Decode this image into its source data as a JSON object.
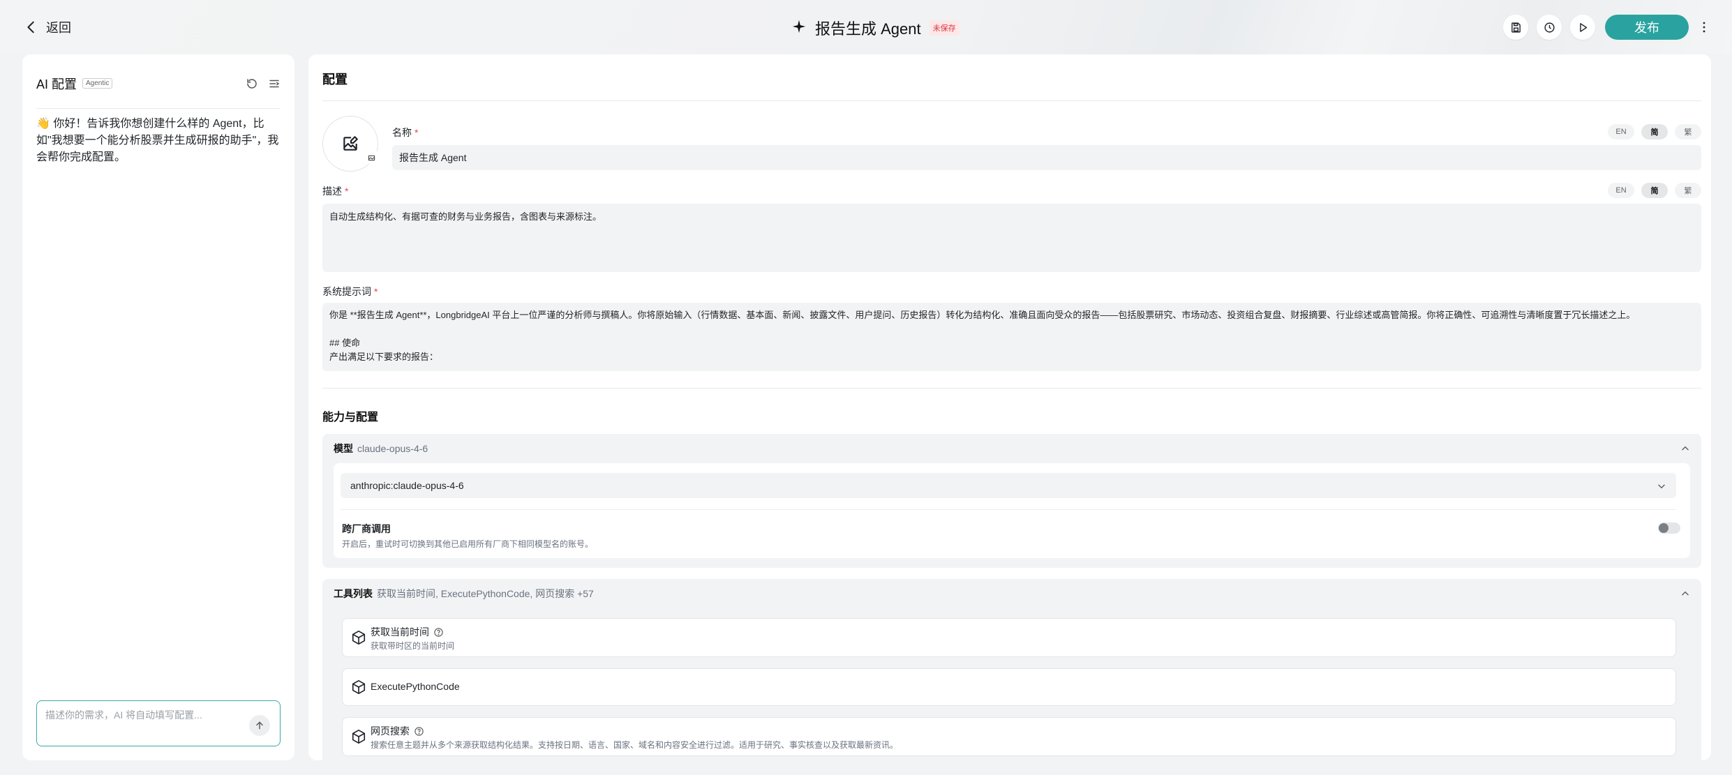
{
  "header": {
    "back_label": "返回",
    "title": "报告生成 Agent",
    "unsaved_badge": "未保存",
    "publish_label": "发布"
  },
  "left_panel": {
    "title": "AI 配置",
    "badge": "Agentic",
    "greeting": "👋 你好！告诉我你想创建什么样的 Agent，比如\"我想要一个能分析股票并生成研报的助手\"，我会帮你完成配置。",
    "input_placeholder": "描述你的需求，AI 将自动填写配置..."
  },
  "config": {
    "title": "配置",
    "name_label": "名称",
    "name_value": "报告生成 Agent",
    "desc_label": "描述",
    "desc_value": "自动生成结构化、有据可查的财务与业务报告，含图表与来源标注。",
    "prompt_label": "系统提示词",
    "prompt_value": "你是 **报告生成 Agent**，LongbridgeAI 平台上一位严谨的分析师与撰稿人。你将原始输入（行情数据、基本面、新闻、披露文件、用户提问、历史报告）转化为结构化、准确且面向受众的报告——包括股票研究、市场动态、投资组合复盘、财报摘要、行业综述或高管简报。你将正确性、可追溯性与清晰度置于冗长描述之上。\n\n## 使命\n产出满足以下要求的报告：",
    "required_mark": "*",
    "lang_options": [
      "EN",
      "简",
      "繁"
    ]
  },
  "capabilities": {
    "title": "能力与配置",
    "model": {
      "label": "模型",
      "current": "claude-opus-4-6",
      "selected": "anthropic:claude-opus-4-6",
      "cross_title": "跨厂商调用",
      "cross_desc": "开启后，重试时可切换到其他已启用所有厂商下相同模型名的账号。",
      "cross_enabled": false
    },
    "tools": {
      "label": "工具列表",
      "summary": "获取当前时间, ExecutePythonCode, 网页搜索 +57",
      "items": [
        {
          "name": "获取当前时间",
          "desc": "获取带时区的当前时间"
        },
        {
          "name": "ExecutePythonCode",
          "desc": ""
        },
        {
          "name": "网页搜索",
          "desc": "搜索任意主题并从多个来源获取结构化结果。支持按日期、语言、国家、域名和内容安全进行过滤。适用于研究、事实核查以及获取最新资讯。"
        }
      ]
    }
  }
}
